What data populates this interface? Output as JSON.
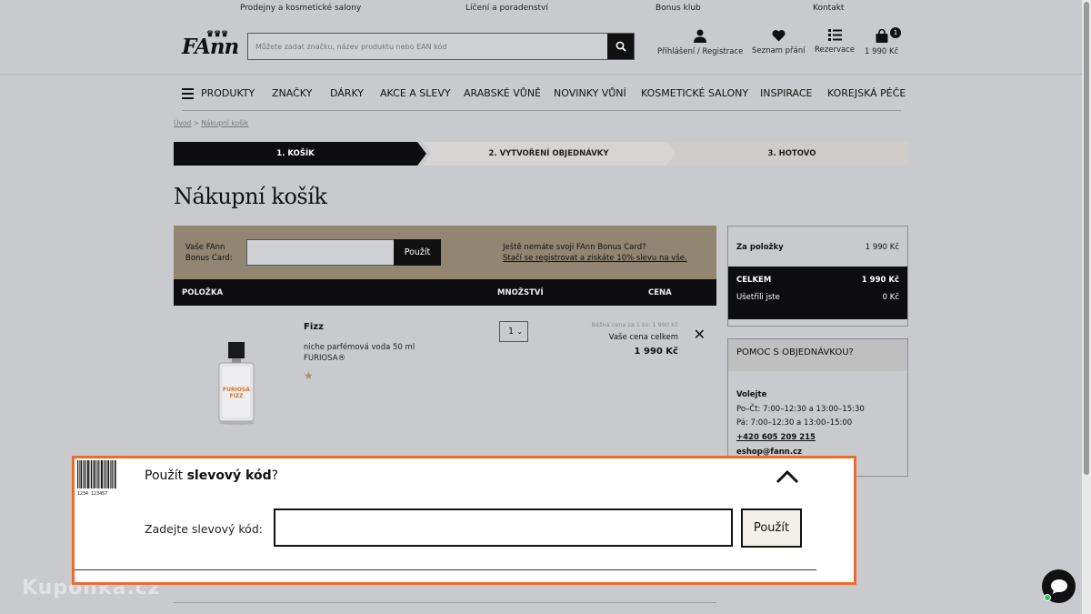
{
  "topbar": {
    "links": [
      "Prodejny a kosmetické salony",
      "Líčení a poradenství",
      "Bonus klub",
      "Kontakt"
    ]
  },
  "header": {
    "logo": "FAnn",
    "search_placeholder": "Můžete zadat značku, název produktu nebo EAN kód",
    "login_label": "Přihlášení / Registrace",
    "wishlist_label": "Seznam přání",
    "reservation_label": "Rezervace",
    "cart_total": "1 990 Kč",
    "cart_count": "1"
  },
  "nav": {
    "items": [
      "PRODUKTY",
      "ZNAČKY",
      "DÁRKY",
      "AKCE A SLEVY",
      "ARABSKÉ VŮNĚ",
      "NOVINKY VŮNÍ",
      "KOSMETICKÉ SALONY",
      "INSPIRACE",
      "KOREJSKÁ PÉČE"
    ]
  },
  "breadcrumb": {
    "home": "Úvod",
    "sep": " > ",
    "current": "Nákupní košík"
  },
  "steps": [
    "1. KOŠÍK",
    "2. VYTVOŘENÍ OBJEDNÁVKY",
    "3. HOTOVO"
  ],
  "page_title": "Nákupní košík",
  "bonus": {
    "label_line1": "Vaše FAnn",
    "label_line2": "Bonus Card:",
    "button": "Použít",
    "info_line1": "Ještě nemáte svoji FAnn Bonus Card?",
    "info_link": "Stačí se registrovat a získáte 10% slevu na vše."
  },
  "table": {
    "col_item": "POLOŽKA",
    "col_qty": "MNOŽSTVÍ",
    "col_price": "CENA"
  },
  "product": {
    "name": "Fizz",
    "desc": "niche parfémová voda 50 ml",
    "brand": "FURIOSA®",
    "bottle_label": "FURIOSA FIZZ",
    "qty": "1",
    "regular_price_note": "Běžná cena za 1 ks: 1 990 Kč",
    "your_price_label": "Vaše cena celkem",
    "price": "1 990 Kč"
  },
  "summary": {
    "items_label": "Za položky",
    "items_value": "1 990 Kč",
    "total_label": "CELKEM",
    "total_value": "1 990 Kč",
    "saved_label": "Ušetřili jste",
    "saved_value": "0 Kč"
  },
  "help": {
    "title": "POMOC S OBJEDNÁVKOU?",
    "call": "Volejte",
    "hours1": "Po–Čt: 7:00–12:30 a 13:00–15:30",
    "hours2": "Pá: 7:00–12:30 a 13:00–15:00",
    "phone": "+420 605 209 215",
    "email": "eshop@fann.cz"
  },
  "discount_panel": {
    "barcode_number": "1234 123457",
    "title_prefix": "Použít ",
    "title_bold": "slevový kód",
    "title_suffix": "?",
    "field_label": "Zadejte slevový kód:",
    "button": "Použít"
  },
  "watermark": "Kupónka.cz",
  "colors": {
    "accent_border": "#ef6a2e",
    "bonus_bar": "#928571",
    "dark": "#0d0d0f",
    "chat_online": "#2ec15a"
  }
}
